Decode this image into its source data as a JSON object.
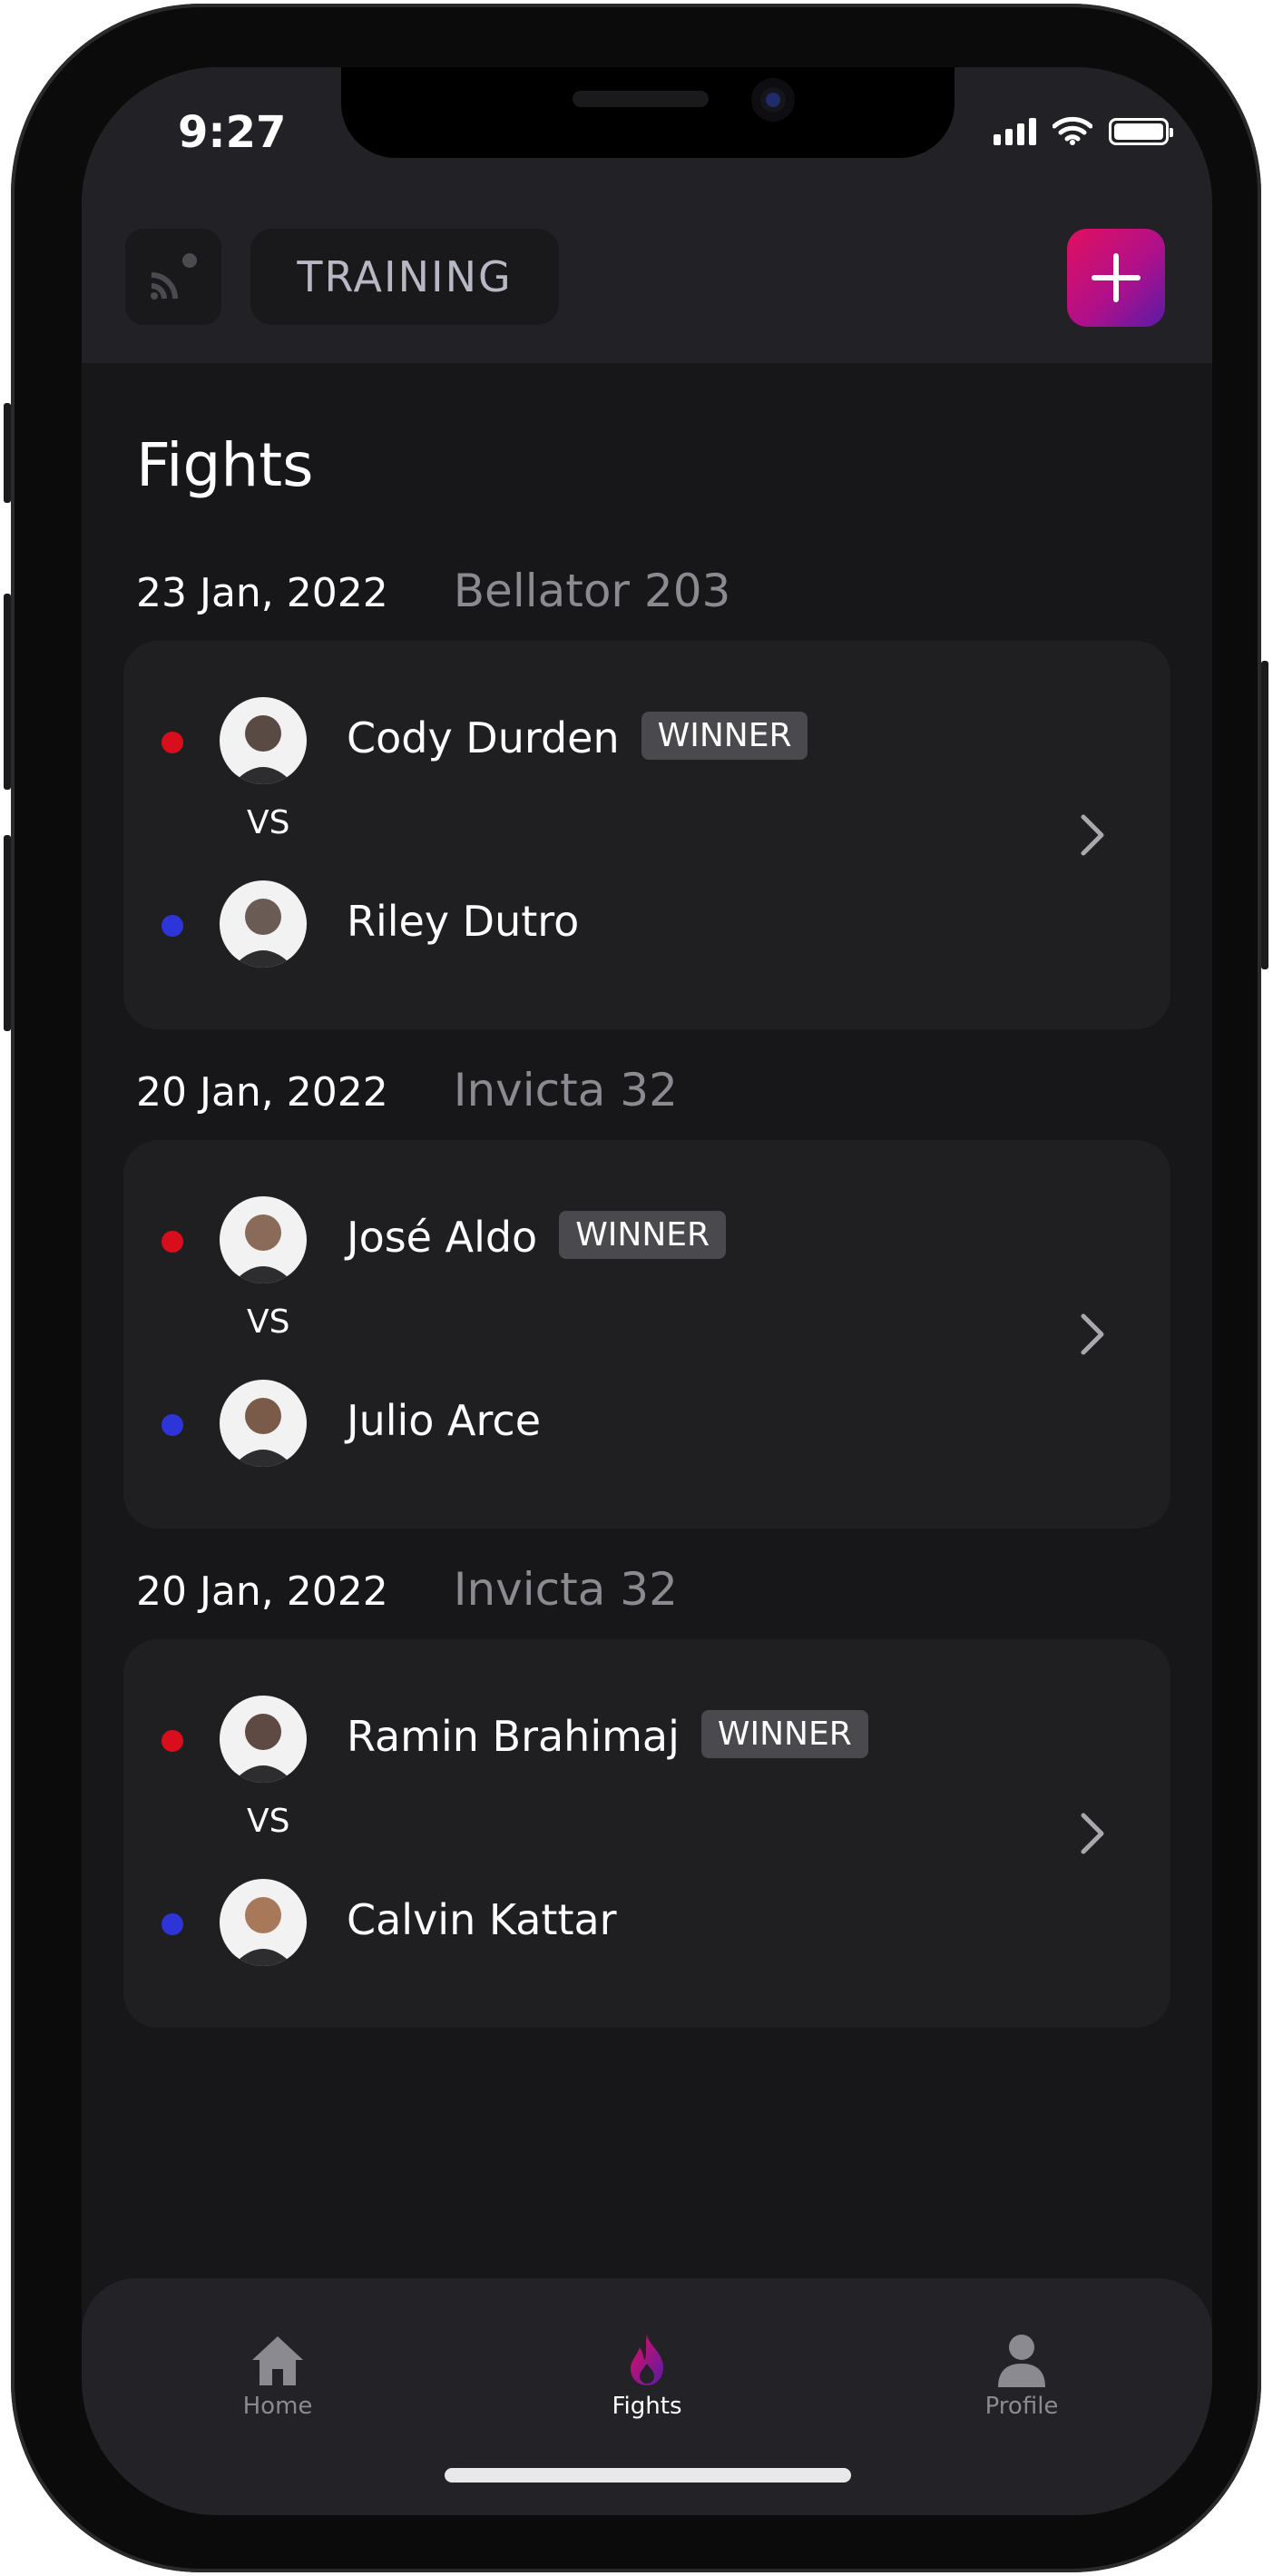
{
  "status": {
    "time": "9:27"
  },
  "appbar": {
    "training_label": "TRAINING",
    "cast_icon": "cast-icon",
    "add_icon": "plus-icon"
  },
  "page": {
    "title": "Fights"
  },
  "colors": {
    "red_corner": "#d90e1c",
    "blue_corner": "#2e35d8",
    "accent_start": "#e11060",
    "accent_end": "#5a1aa8",
    "tab_active": "#ffffff",
    "tab_inactive": "#8a8a90"
  },
  "fights": [
    {
      "date": "23 Jan, 2022",
      "event": "Bellator 203",
      "red": {
        "name": "Cody Durden",
        "badge": "WINNER"
      },
      "vs": "VS",
      "blue": {
        "name": "Riley Dutro"
      }
    },
    {
      "date": "20 Jan, 2022",
      "event": "Invicta 32",
      "red": {
        "name": "José Aldo",
        "badge": "WINNER"
      },
      "vs": "VS",
      "blue": {
        "name": "Julio Arce"
      }
    },
    {
      "date": "20 Jan, 2022",
      "event": "Invicta 32",
      "red": {
        "name": "Ramin Brahimaj",
        "badge": "WINNER"
      },
      "vs": "VS",
      "blue": {
        "name": "Calvin Kattar"
      }
    }
  ],
  "tabbar": {
    "items": [
      {
        "label": "Home",
        "icon": "home-icon",
        "active": false
      },
      {
        "label": "Fights",
        "icon": "flame-icon",
        "active": true
      },
      {
        "label": "Profile",
        "icon": "person-icon",
        "active": false
      }
    ]
  }
}
